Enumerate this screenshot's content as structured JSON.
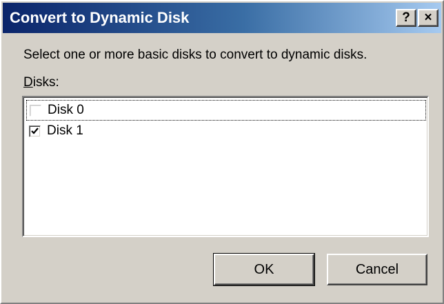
{
  "window": {
    "title": "Convert to Dynamic Disk",
    "help_glyph": "?",
    "close_glyph": "×"
  },
  "instruction": "Select one or more basic disks to convert to dynamic disks.",
  "disks_label": {
    "accel": "D",
    "rest": "isks:"
  },
  "disks": [
    {
      "label": "Disk 0",
      "checked": false
    },
    {
      "label": "Disk 1",
      "checked": true
    }
  ],
  "buttons": {
    "ok": "OK",
    "cancel": "Cancel"
  }
}
